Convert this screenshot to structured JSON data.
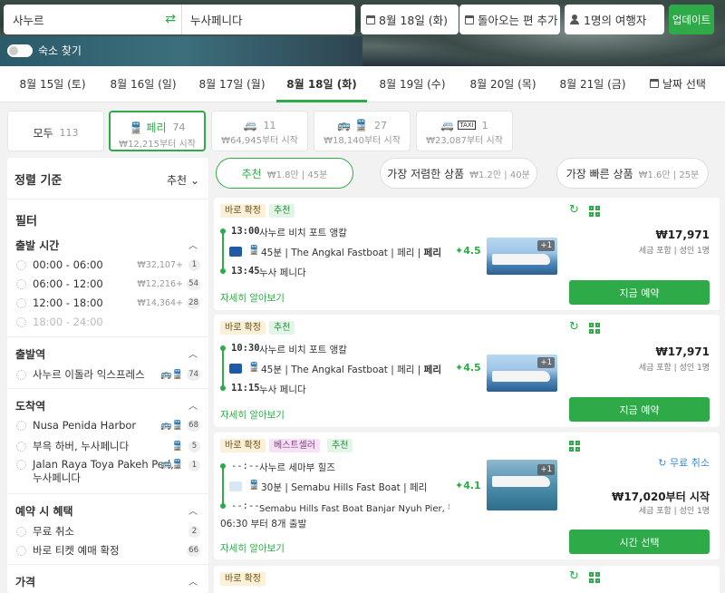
{
  "search": {
    "from": "사누르",
    "to": "누사페니다",
    "date": "8월 18일 (화)",
    "return": "돌아오는 편 추가",
    "passengers": "1명의 여행자",
    "update": "업데이트",
    "hotel_toggle": "숙소 찾기"
  },
  "dates": [
    {
      "label": "8월 15일 (토)"
    },
    {
      "label": "8월 16일 (일)"
    },
    {
      "label": "8월 17일 (월)"
    },
    {
      "label": "8월 18일 (화)",
      "active": true
    },
    {
      "label": "8월 19일 (수)"
    },
    {
      "label": "8월 20일 (목)"
    },
    {
      "label": "8월 21일 (금)"
    },
    {
      "label": "날짜 선택"
    }
  ],
  "modes": {
    "all": {
      "label": "모두",
      "count": "113"
    },
    "ferry": {
      "label": "페리",
      "count": "74",
      "price": "₩12,215부터 시작"
    },
    "van": {
      "count": "11",
      "price": "₩64,945부터 시작"
    },
    "bus_ferry": {
      "count": "27",
      "price": "₩18,140부터 시작"
    },
    "taxi": {
      "count": "1",
      "price": "₩23,087부터 시작",
      "taxi_text": "TAXI"
    }
  },
  "sidebar": {
    "sort_label": "정렬 기준",
    "sort_value": "추천",
    "filter_title": "필터",
    "departure_time": {
      "title": "출발 시간",
      "items": [
        {
          "label": "00:00 - 06:00",
          "price": "₩32,107+",
          "count": "1"
        },
        {
          "label": "06:00 - 12:00",
          "price": "₩12,216+",
          "count": "54"
        },
        {
          "label": "12:00 - 18:00",
          "price": "₩14,364+",
          "count": "28"
        },
        {
          "label": "18:00 - 24:00"
        }
      ]
    },
    "departure_station": {
      "title": "출발역",
      "items": [
        {
          "label": "사누르 이돌라 익스프레스",
          "count": "74"
        }
      ]
    },
    "arrival_station": {
      "title": "도착역",
      "items": [
        {
          "label": "Nusa Penida Harbor",
          "count": "68"
        },
        {
          "label": "부윽 하버, 누사페니다",
          "count": "5"
        },
        {
          "label": "Jalan Raya Toya Pakeh Ped,",
          "label2": "누사페니다",
          "count": "1"
        }
      ]
    },
    "benefits": {
      "title": "예약 시 혜택",
      "items": [
        {
          "label": "무료 취소",
          "count": "2"
        },
        {
          "label": "바로 티켓 예매 확정",
          "count": "66"
        }
      ]
    },
    "price_title": "가격"
  },
  "sort_tabs": [
    {
      "label": "추천",
      "sub": "₩1.8만 | 45분",
      "selected": true
    },
    {
      "label": "가장 저렴한 상품",
      "sub": "₩1.2만 | 40분"
    },
    {
      "label": "가장 빠른 상품",
      "sub": "₩1.6만 | 25분"
    }
  ],
  "results": [
    {
      "tags": [
        "바로 확정",
        "추천"
      ],
      "dep_time": "13:00",
      "dep_place": "사누르 비치 포트 앵칼",
      "operator": "45분 | The Angkal Fastboat | 페리 | ",
      "operator_bold": "페리",
      "arr_time": "13:45",
      "arr_place": "누사 페니다",
      "rating": "4.5",
      "photo_more": "+1",
      "price": "₩17,971",
      "price_note": "세금 포함 | 성인 1명",
      "button": "지금 예약",
      "more": "자세히 알아보기"
    },
    {
      "tags": [
        "바로 확정",
        "추천"
      ],
      "dep_time": "10:30",
      "dep_place": "사누르 비치 포트 앵칼",
      "operator": "45분 | The Angkal Fastboat | 페리 | ",
      "operator_bold": "페리",
      "arr_time": "11:15",
      "arr_place": "누사 페니다",
      "rating": "4.5",
      "photo_more": "+1",
      "price": "₩17,971",
      "price_note": "세금 포함 | 성인 1명",
      "button": "지금 예약",
      "more": "자세히 알아보기"
    },
    {
      "tags": [
        "바로 확정",
        "베스트셀러",
        "추천"
      ],
      "dep_time": "--:--",
      "dep_place": "사누르 세마부 힐즈",
      "operator": "30분 | Semabu Hills Fast Boat | 페리",
      "arr_time": "--:--",
      "arr_place": "Semabu Hills Fast Boat Banjar Nyuh Pier, 누사페...",
      "extra": "06:30 부터 8개 출발",
      "rating": "4.1",
      "photo_more": "+1",
      "cancel": "무료 취소",
      "price": "₩17,020부터 시작",
      "price_note": "세금 포함 | 성인 1명",
      "button": "시간 선택",
      "more": "자세히 알아보기"
    },
    {
      "tags": [
        "바로 확정"
      ]
    }
  ],
  "colors": {
    "accent": "#2eaa48",
    "link_blue": "#3a8ad6"
  },
  "icons": {
    "swap": "swap-icon",
    "calendar": "calendar-icon",
    "person": "person-icon",
    "ferry": "ferry-icon",
    "van": "van-icon",
    "bus": "bus-icon",
    "taxi": "taxi-icon",
    "refresh": "refresh-icon",
    "qr": "qr-icon",
    "star": "star-icon",
    "chevron": "chevron-icon"
  }
}
